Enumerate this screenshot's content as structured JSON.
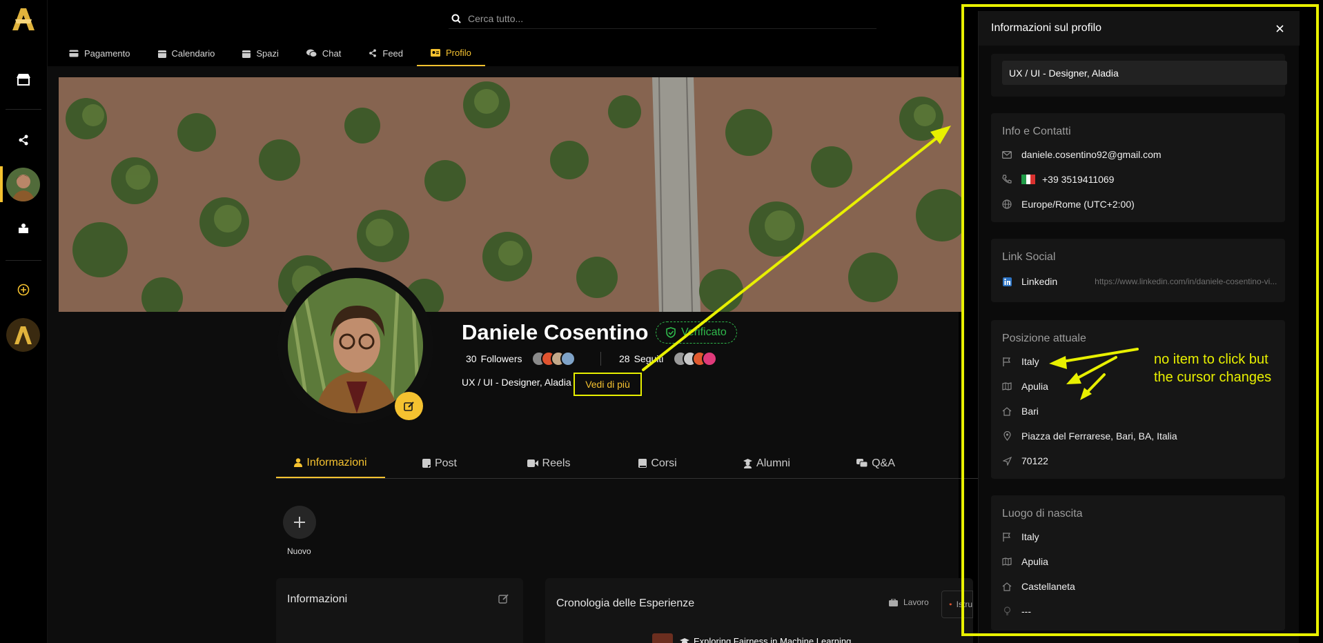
{
  "search": {
    "placeholder": "Cerca tutto..."
  },
  "top_tabs": [
    {
      "label": "Pagamento",
      "icon": "credit-card-icon"
    },
    {
      "label": "Calendario",
      "icon": "calendar-icon"
    },
    {
      "label": "Spazi",
      "icon": "calendar-icon"
    },
    {
      "label": "Chat",
      "icon": "chat-icon"
    },
    {
      "label": "Feed",
      "icon": "share-icon"
    },
    {
      "label": "Profilo",
      "icon": "id-card-icon",
      "active": true
    }
  ],
  "profile": {
    "name": "Daniele Cosentino",
    "verified_label": "Verificato",
    "followers_count": "30",
    "followers_label": "Followers",
    "following_count": "28",
    "following_label": "Seguiti",
    "headline": "UX / UI - Designer, Aladia",
    "see_more": "Vedi di più"
  },
  "profile_tabs": [
    {
      "label": "Informazioni",
      "icon": "user-icon",
      "active": true
    },
    {
      "label": "Post",
      "icon": "note-icon"
    },
    {
      "label": "Reels",
      "icon": "video-icon"
    },
    {
      "label": "Corsi",
      "icon": "book-icon"
    },
    {
      "label": "Alumni",
      "icon": "graduate-icon"
    },
    {
      "label": "Q&A",
      "icon": "comments-icon"
    }
  ],
  "new_story": {
    "label": "Nuovo"
  },
  "info_card": {
    "title": "Informazioni"
  },
  "experience_card": {
    "title": "Cronologia delle Esperienze",
    "filter_work": "Lavoro",
    "filter_edu": "Istru",
    "first_item": "Exploring Fairness in Machine Learning"
  },
  "panel": {
    "title": "Informazioni sul profilo",
    "job": "UX / UI - Designer, Aladia",
    "contacts": {
      "title": "Info e Contatti",
      "email": "daniele.cosentino92@gmail.com",
      "phone": "+39 3519411069",
      "timezone": "Europe/Rome (UTC+2:00)"
    },
    "social": {
      "title": "Link Social",
      "network": "Linkedin",
      "url": "https://www.linkedin.com/in/daniele-cosentino-vi..."
    },
    "current_position": {
      "title": "Posizione attuale",
      "country": "Italy",
      "region": "Apulia",
      "city": "Bari",
      "address": "Piazza del Ferrarese, Bari, BA, Italia",
      "postal_code": "70122"
    },
    "birthplace": {
      "title": "Luogo di nascita",
      "country": "Italy",
      "region": "Apulia",
      "city": "Castellaneta",
      "place": "---"
    }
  },
  "annotation": {
    "note_line1": "no item to click but",
    "note_line2": "the cursor changes"
  },
  "colors": {
    "accent": "#f5c230",
    "annotation": "#e8f000",
    "verified": "#2fb84b"
  }
}
